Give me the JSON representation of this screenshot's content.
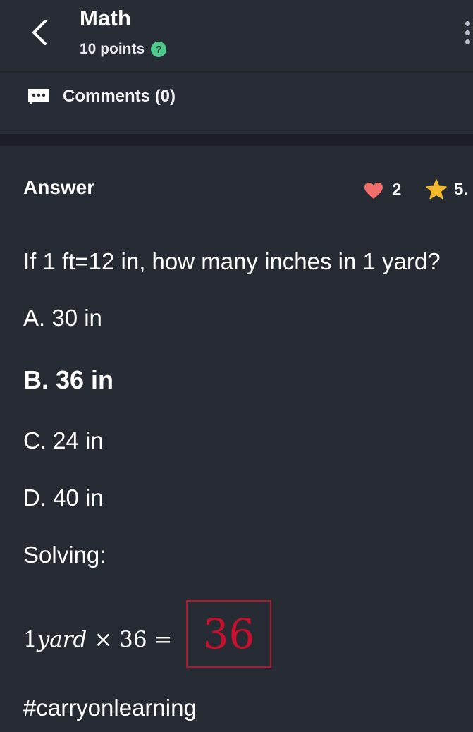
{
  "header": {
    "subject": "Math",
    "points": "10 points",
    "help_icon": "question-icon",
    "help_symbol": "?",
    "help_color": "#4ecb8d"
  },
  "comments": {
    "label": "Comments (0)",
    "icon": "comment-bubble-icon"
  },
  "answer": {
    "title": "Answer",
    "likes": "2",
    "like_icon": "heart-icon",
    "like_color": "#f06d6a",
    "rating": "5.",
    "rating_icon": "star-icon",
    "rating_color": "#f5b92d",
    "question": "If 1 ft=12 in, how many inches in 1 yard?",
    "options": [
      "A. 30 in",
      "B. 36 in",
      "C. 24 in",
      "D. 40 in"
    ],
    "selected_option": "B. 36 in",
    "solving_label": "Solving:",
    "equation": {
      "left_number": "1",
      "left_var": "yard",
      "operator": "×",
      "multiplier": "36",
      "equals": "=",
      "result": "36"
    },
    "result_color": "#c8102e",
    "hashtag": "#carryonlearning"
  }
}
